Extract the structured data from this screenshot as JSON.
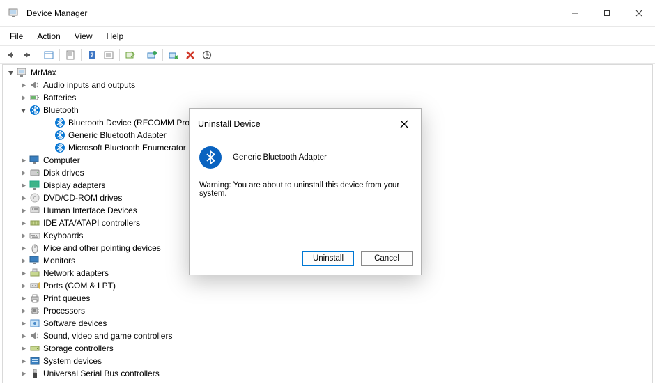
{
  "titlebar": {
    "title": "Device Manager"
  },
  "menubar": {
    "file": "File",
    "action": "Action",
    "view": "View",
    "help": "Help"
  },
  "tree": {
    "root": "MrMax",
    "items": [
      {
        "label": "Audio inputs and outputs",
        "expanded": false,
        "icon": "speaker"
      },
      {
        "label": "Batteries",
        "expanded": false,
        "icon": "battery"
      },
      {
        "label": "Bluetooth",
        "expanded": true,
        "icon": "bluetooth",
        "children": [
          {
            "label": "Bluetooth Device (RFCOMM Protocol TDI)",
            "icon": "bluetooth"
          },
          {
            "label": "Generic Bluetooth Adapter",
            "icon": "bluetooth"
          },
          {
            "label": "Microsoft Bluetooth Enumerator",
            "icon": "bluetooth"
          }
        ]
      },
      {
        "label": "Computer",
        "expanded": false,
        "icon": "monitor"
      },
      {
        "label": "Disk drives",
        "expanded": false,
        "icon": "disk"
      },
      {
        "label": "Display adapters",
        "expanded": false,
        "icon": "display"
      },
      {
        "label": "DVD/CD-ROM drives",
        "expanded": false,
        "icon": "cd"
      },
      {
        "label": "Human Interface Devices",
        "expanded": false,
        "icon": "hid"
      },
      {
        "label": "IDE ATA/ATAPI controllers",
        "expanded": false,
        "icon": "ide"
      },
      {
        "label": "Keyboards",
        "expanded": false,
        "icon": "keyboard"
      },
      {
        "label": "Mice and other pointing devices",
        "expanded": false,
        "icon": "mouse"
      },
      {
        "label": "Monitors",
        "expanded": false,
        "icon": "monitor"
      },
      {
        "label": "Network adapters",
        "expanded": false,
        "icon": "network"
      },
      {
        "label": "Ports (COM & LPT)",
        "expanded": false,
        "icon": "port"
      },
      {
        "label": "Print queues",
        "expanded": false,
        "icon": "printer"
      },
      {
        "label": "Processors",
        "expanded": false,
        "icon": "cpu"
      },
      {
        "label": "Software devices",
        "expanded": false,
        "icon": "software"
      },
      {
        "label": "Sound, video and game controllers",
        "expanded": false,
        "icon": "sound"
      },
      {
        "label": "Storage controllers",
        "expanded": false,
        "icon": "storage"
      },
      {
        "label": "System devices",
        "expanded": false,
        "icon": "system"
      },
      {
        "label": "Universal Serial Bus controllers",
        "expanded": false,
        "icon": "usb"
      }
    ]
  },
  "dialog": {
    "title": "Uninstall Device",
    "device": "Generic Bluetooth Adapter",
    "warning": "Warning: You are about to uninstall this device from your system.",
    "uninstall": "Uninstall",
    "cancel": "Cancel"
  }
}
